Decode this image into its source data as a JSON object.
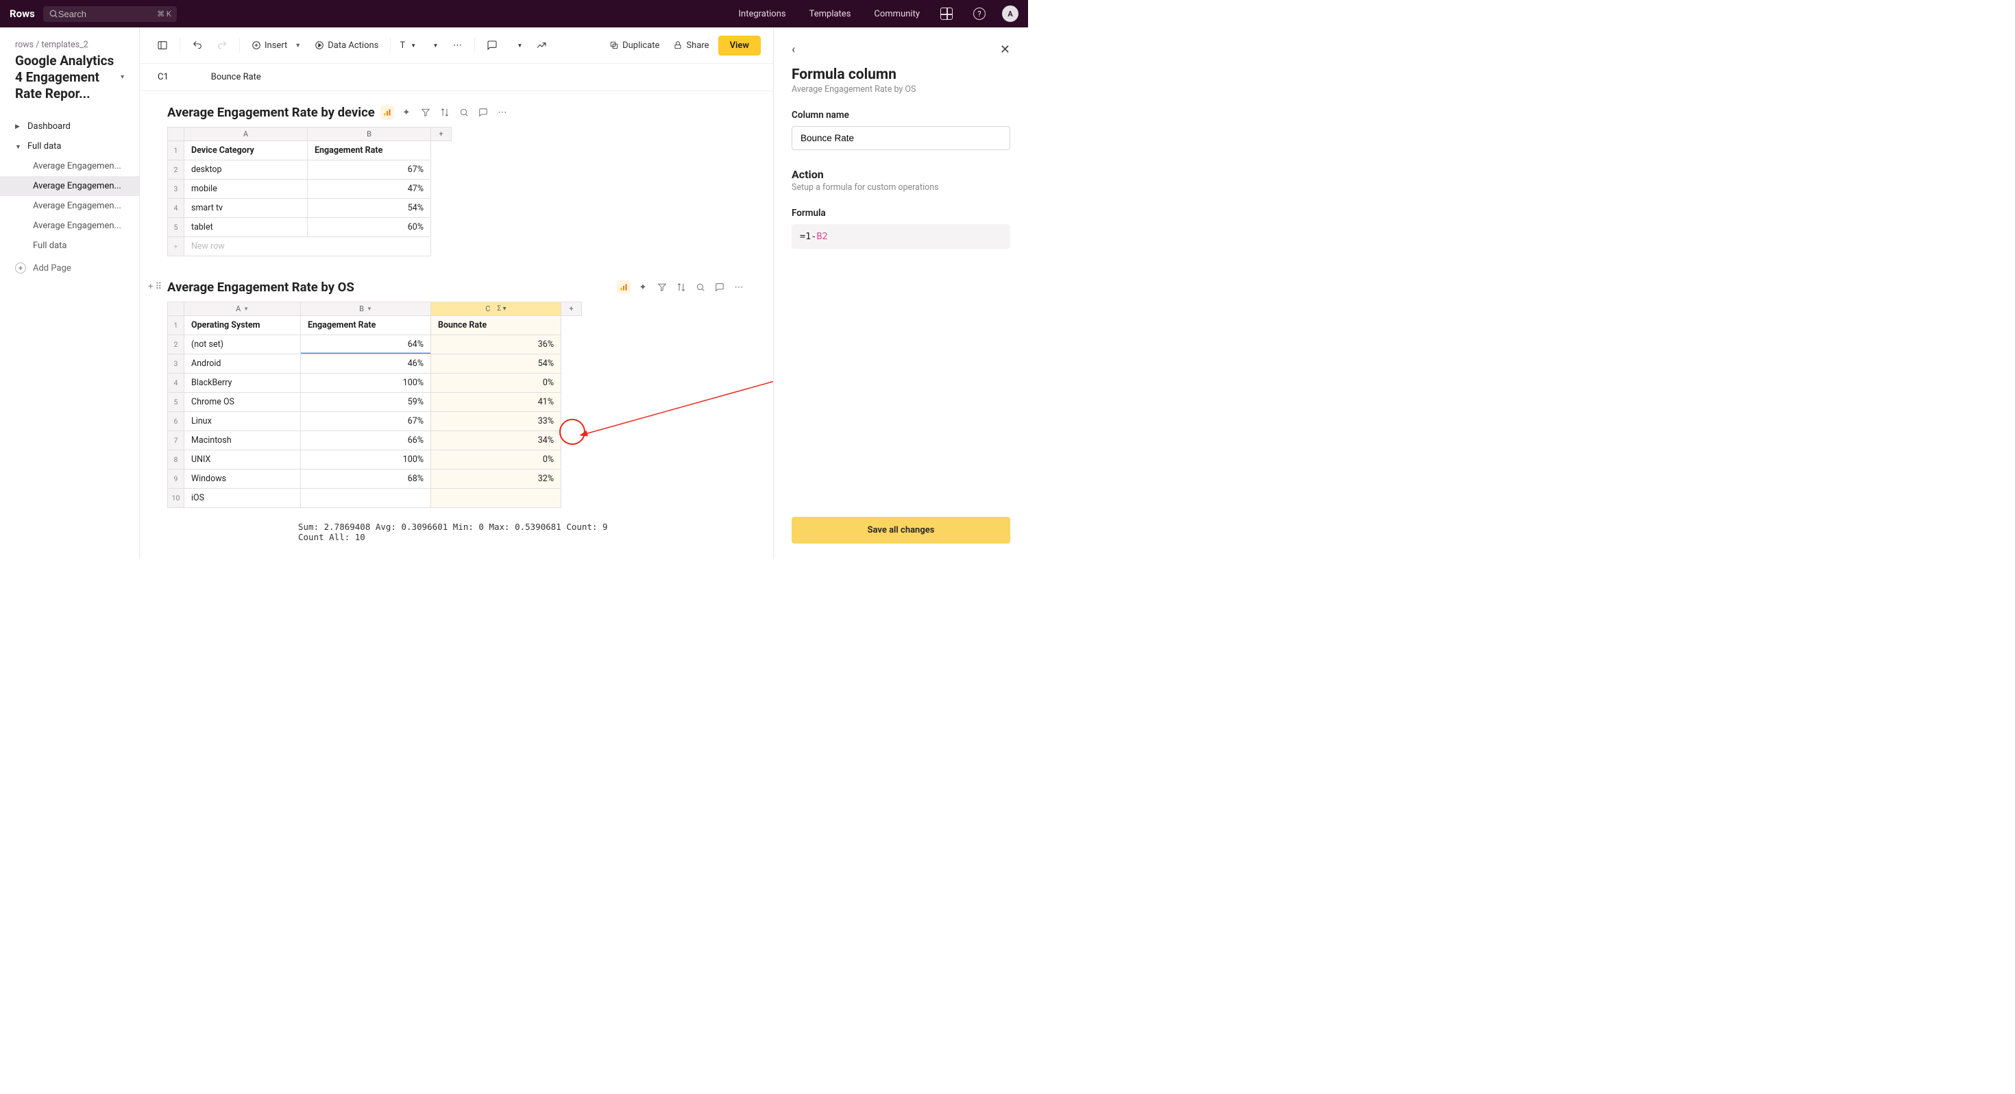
{
  "topbar": {
    "brand": "Rows",
    "search_placeholder": "Search",
    "search_kbd": "⌘ K",
    "links": [
      "Integrations",
      "Templates",
      "Community"
    ],
    "avatar_initial": "A"
  },
  "sidebar": {
    "breadcrumb": "rows / templates_2",
    "doc_title": "Google Analytics 4 Engagement Rate Repor...",
    "items": [
      {
        "label": "Dashboard",
        "expanded": false,
        "children": []
      },
      {
        "label": "Full data",
        "expanded": true,
        "children": [
          "Average Engagemen...",
          "Average Engagemen...",
          "Average Engagemen...",
          "Average Engagemen...",
          "Full data"
        ],
        "active_child_index": 1
      }
    ],
    "add_page": "Add Page"
  },
  "toolbar": {
    "insert": "Insert",
    "data_actions": "Data Actions",
    "duplicate": "Duplicate",
    "share": "Share",
    "view": "View"
  },
  "formula_bar": {
    "cell": "C1",
    "value": "Bounce Rate"
  },
  "table1": {
    "title": "Average Engagement Rate by device",
    "cols": [
      "A",
      "B"
    ],
    "headers": [
      "Device Category",
      "Engagement Rate"
    ],
    "rows": [
      [
        "desktop",
        "67%"
      ],
      [
        "mobile",
        "47%"
      ],
      [
        "smart tv",
        "54%"
      ],
      [
        "tablet",
        "60%"
      ]
    ],
    "new_row": "New row"
  },
  "table2": {
    "title": "Average Engagement Rate by OS",
    "cols": [
      "A",
      "B",
      "C"
    ],
    "headers": [
      "Operating System",
      "Engagement Rate",
      "Bounce Rate"
    ],
    "rows": [
      [
        "(not set)",
        "64%",
        "36%"
      ],
      [
        "Android",
        "46%",
        "54%"
      ],
      [
        "BlackBerry",
        "100%",
        "0%"
      ],
      [
        "Chrome OS",
        "59%",
        "41%"
      ],
      [
        "Linux",
        "67%",
        "33%"
      ],
      [
        "Macintosh",
        "66%",
        "34%"
      ],
      [
        "UNIX",
        "100%",
        "0%"
      ],
      [
        "Windows",
        "68%",
        "32%"
      ],
      [
        "iOS",
        "",
        ""
      ]
    ]
  },
  "status_bar": "Sum: 2.7869408 Avg: 0.3096601 Min: 0 Max: 0.5390681 Count: 9 Count All: 10",
  "right_panel": {
    "title": "Formula column",
    "subtitle": "Average Engagement Rate by OS",
    "col_name_label": "Column name",
    "col_name_value": "Bounce Rate",
    "action_title": "Action",
    "action_sub": "Setup a formula for custom operations",
    "formula_label": "Formula",
    "formula_prefix": "=1-",
    "formula_ref": "B2",
    "save": "Save all changes"
  }
}
